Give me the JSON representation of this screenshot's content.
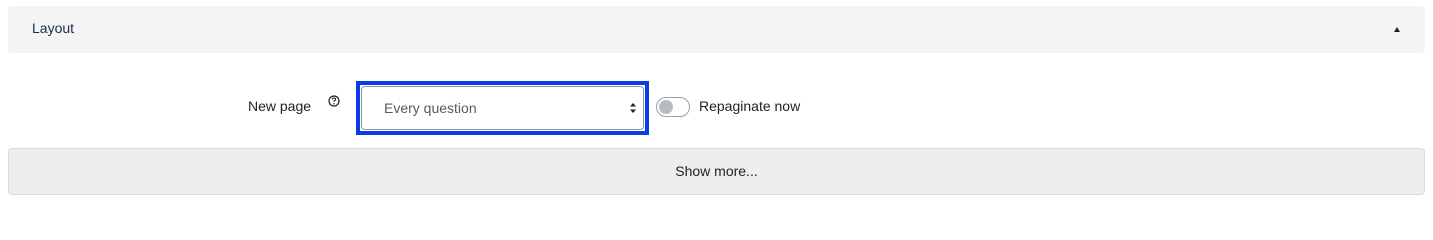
{
  "section": {
    "title": "Layout",
    "collapse_icon": "chevron-up-icon"
  },
  "new_page": {
    "label": "New page",
    "help_icon": "help-icon",
    "selected_option": "Every question"
  },
  "repaginate": {
    "label": "Repaginate now",
    "checked": false
  },
  "show_more": {
    "label": "Show more..."
  },
  "colors": {
    "focus_outline": "#0a3be8",
    "header_bg": "#f4f4f4",
    "button_bg": "#eeeeee"
  }
}
